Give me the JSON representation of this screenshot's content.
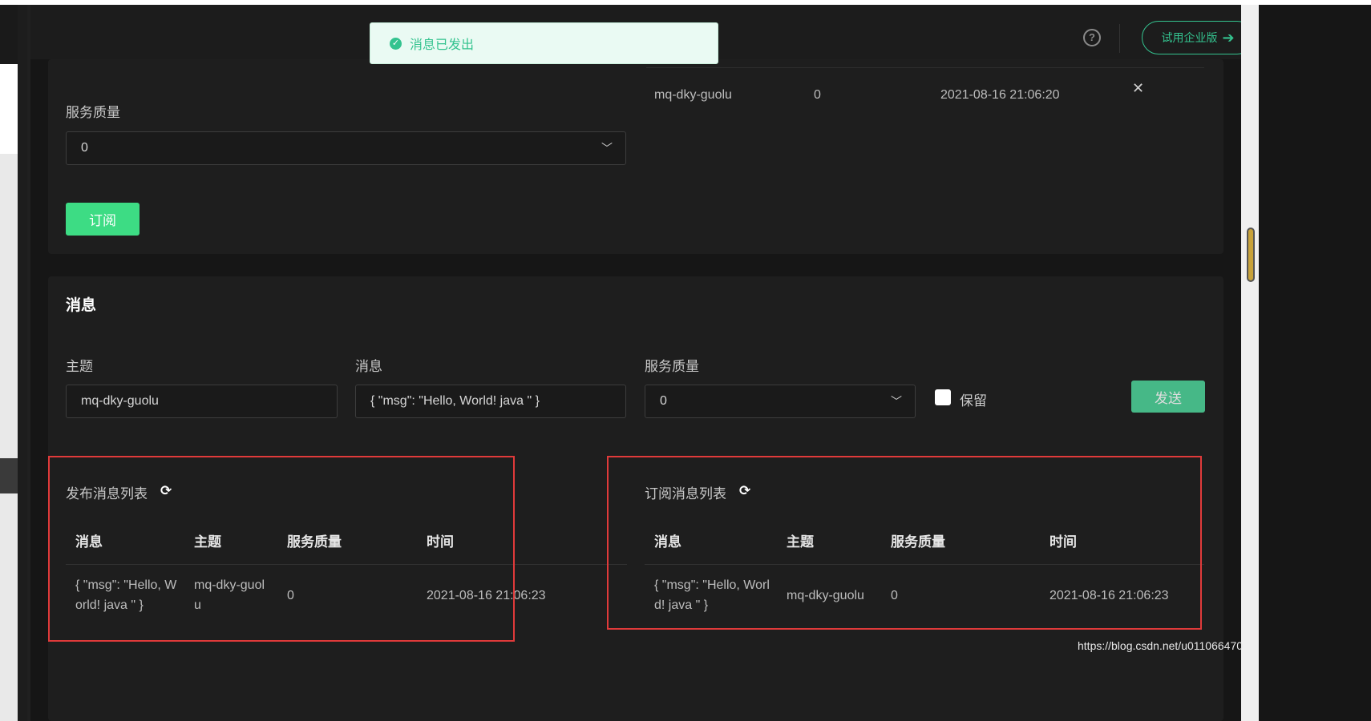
{
  "header": {
    "help_icon": "question-circle-icon",
    "trial_button": {
      "label": "试用企业版",
      "icon": "arrow-right-icon"
    }
  },
  "toast": {
    "icon": "check-circle-icon",
    "text": "消息已发出"
  },
  "subscription": {
    "qos_label": "服务质量",
    "qos_value": "0",
    "subscribe_button": "订阅",
    "list_row": {
      "topic": "mq-dky-guolu",
      "qos": "0",
      "time": "2021-08-16 21:06:20",
      "remove_icon": "close-icon"
    }
  },
  "message": {
    "title": "消息",
    "topic_label": "主题",
    "topic_value": "mq-dky-guolu",
    "msg_label": "消息",
    "msg_value": "{ \"msg\": \"Hello, World!  java \" }",
    "qos_label": "服务质量",
    "qos_value": "0",
    "retain_label": "保留",
    "send_button": "发送"
  },
  "published_list": {
    "title": "发布消息列表",
    "refresh_icon": "refresh-icon",
    "columns": [
      "消息",
      "主题",
      "服务质量",
      "时间"
    ],
    "rows": [
      {
        "msg_line1": "{ \"msg\": \"Hello, W",
        "msg_line2": "orld! java \" }",
        "topic_line1": "mq-dky-guol",
        "topic_line2": "u",
        "qos": "0",
        "time": "2021-08-16 21:06:23"
      }
    ]
  },
  "subscribed_list": {
    "title": "订阅消息列表",
    "refresh_icon": "refresh-icon",
    "columns": [
      "消息",
      "主题",
      "服务质量",
      "时间"
    ],
    "rows": [
      {
        "msg_line1": "{ \"msg\": \"Hello, Worl",
        "msg_line2": "d! java \" }",
        "topic": "mq-dky-guolu",
        "qos": "0",
        "time": "2021-08-16 21:06:23"
      }
    ]
  },
  "watermark": "https://blog.csdn.net/u011066470",
  "colors": {
    "accent": "#3ddc84",
    "highlight_box": "#e03a3a",
    "background": "#161616"
  }
}
